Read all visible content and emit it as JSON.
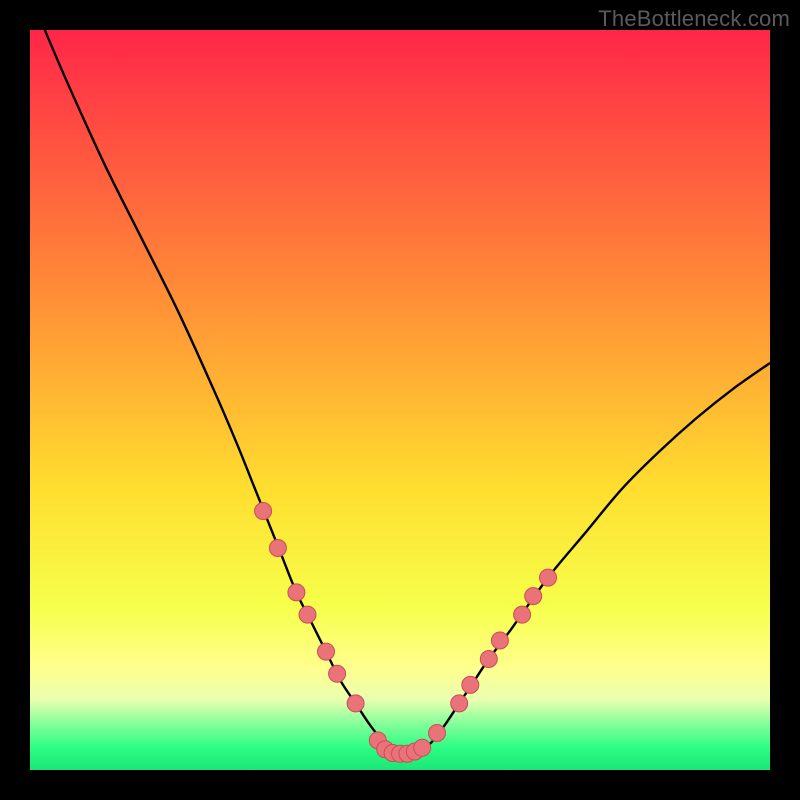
{
  "watermark": "TheBottleneck.com",
  "colors": {
    "black": "#000000",
    "curve": "#000000",
    "dot_fill": "#e97379",
    "dot_stroke": "#c84e56",
    "grad_top": "#ff2648",
    "grad_upper_mid": "#ff8b37",
    "grad_mid": "#ffde2f",
    "grad_lower_mid": "#f6ff4b",
    "grad_yellow2": "#ffff8c",
    "grad_pale": "#e9ffb0",
    "grad_green_light": "#8cff9c",
    "grad_green": "#2dfd83",
    "grad_green_dark": "#1be578"
  },
  "chart_data": {
    "type": "line",
    "title": "",
    "xlabel": "",
    "ylabel": "",
    "xlim": [
      0,
      100
    ],
    "ylim": [
      0,
      100
    ],
    "series": [
      {
        "name": "bottleneck-curve",
        "x": [
          2,
          5,
          10,
          15,
          20,
          25,
          28,
          30,
          32,
          34,
          36,
          38,
          40,
          42,
          44,
          46,
          48,
          49,
          50,
          51,
          52,
          54,
          56,
          58,
          60,
          62,
          65,
          70,
          75,
          80,
          85,
          90,
          95,
          100
        ],
        "y": [
          100,
          93,
          82,
          72,
          62,
          51,
          44,
          39,
          34,
          29,
          24,
          20,
          16,
          12,
          9,
          6,
          3.5,
          2.5,
          2.2,
          2.2,
          2.5,
          3.5,
          6,
          9,
          12,
          15,
          19,
          26,
          32,
          38,
          43,
          47.5,
          51.5,
          55
        ]
      }
    ],
    "dots": [
      {
        "x": 31.5,
        "y": 35
      },
      {
        "x": 33.5,
        "y": 30
      },
      {
        "x": 36,
        "y": 24
      },
      {
        "x": 37.5,
        "y": 21
      },
      {
        "x": 40,
        "y": 16
      },
      {
        "x": 41.5,
        "y": 13
      },
      {
        "x": 44,
        "y": 9
      },
      {
        "x": 47,
        "y": 4
      },
      {
        "x": 48,
        "y": 2.8
      },
      {
        "x": 49,
        "y": 2.3
      },
      {
        "x": 50,
        "y": 2.2
      },
      {
        "x": 51,
        "y": 2.2
      },
      {
        "x": 52,
        "y": 2.5
      },
      {
        "x": 53,
        "y": 3
      },
      {
        "x": 55,
        "y": 5
      },
      {
        "x": 58,
        "y": 9
      },
      {
        "x": 59.5,
        "y": 11.5
      },
      {
        "x": 62,
        "y": 15
      },
      {
        "x": 63.5,
        "y": 17.5
      },
      {
        "x": 66.5,
        "y": 21
      },
      {
        "x": 68,
        "y": 23.5
      },
      {
        "x": 70,
        "y": 26
      }
    ],
    "gradient_stops": [
      {
        "offset": 0,
        "key": "grad_top"
      },
      {
        "offset": 0.35,
        "key": "grad_upper_mid"
      },
      {
        "offset": 0.62,
        "key": "grad_mid"
      },
      {
        "offset": 0.78,
        "key": "grad_lower_mid"
      },
      {
        "offset": 0.86,
        "key": "grad_yellow2"
      },
      {
        "offset": 0.905,
        "key": "grad_pale"
      },
      {
        "offset": 0.935,
        "key": "grad_green_light"
      },
      {
        "offset": 0.97,
        "key": "grad_green"
      },
      {
        "offset": 1.0,
        "key": "grad_green_dark"
      }
    ]
  }
}
